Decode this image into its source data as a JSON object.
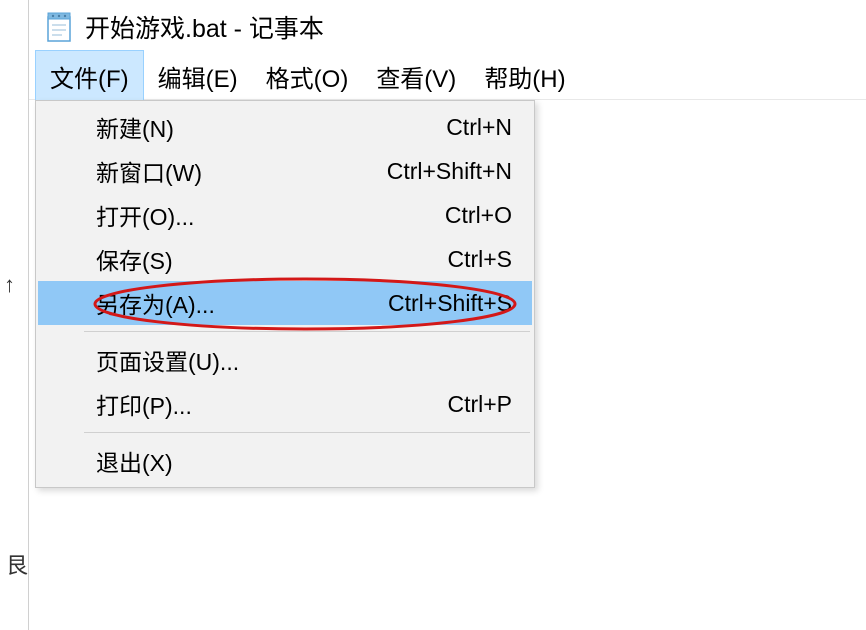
{
  "window": {
    "title": "开始游戏.bat - 记事本"
  },
  "menubar": {
    "file": "文件(F)",
    "edit": "编辑(E)",
    "format": "格式(O)",
    "view": "查看(V)",
    "help": "帮助(H)"
  },
  "file_menu": {
    "new_label": "新建(N)",
    "new_shortcut": "Ctrl+N",
    "new_window_label": "新窗口(W)",
    "new_window_shortcut": "Ctrl+Shift+N",
    "open_label": "打开(O)...",
    "open_shortcut": "Ctrl+O",
    "save_label": "保存(S)",
    "save_shortcut": "Ctrl+S",
    "save_as_label": "另存为(A)...",
    "save_as_shortcut": "Ctrl+Shift+S",
    "page_setup_label": "页面设置(U)...",
    "print_label": "打印(P)...",
    "print_shortcut": "Ctrl+P",
    "exit_label": "退出(X)"
  },
  "annotation": {
    "highlight_color": "#90c8f6",
    "ellipse_color": "#d31818"
  }
}
